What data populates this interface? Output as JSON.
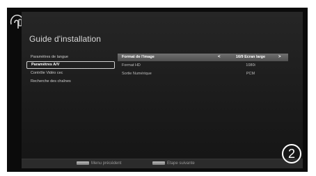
{
  "app": {
    "title": "Guide d'installation"
  },
  "menu": {
    "items": [
      {
        "label": "Paramètres de langue",
        "selected": false
      },
      {
        "label": "Paramètres A/V",
        "selected": true
      },
      {
        "label": "Contrôle Vidéo cec",
        "selected": false
      },
      {
        "label": "Recherche des chaînes",
        "selected": false
      }
    ]
  },
  "settings": {
    "rows": [
      {
        "label": "Format de l'image",
        "value": "16/9 Ecran large",
        "arrow_left": "<",
        "arrow_right": ">",
        "highlighted": true
      },
      {
        "label": "Format HD",
        "value": "1080i",
        "highlighted": false
      },
      {
        "label": "Sortie Numérique",
        "value": "PCM",
        "highlighted": false
      }
    ]
  },
  "footer": {
    "previous_label": "Menu précédent",
    "next_label": "Etape suivante"
  },
  "step": {
    "number": "2"
  },
  "icons": [
    "remote-hand-icon",
    "left-arrow-icon",
    "right-arrow-icon",
    "red-key-icon",
    "green-key-icon"
  ],
  "colors": {
    "highlight": "#5f5f5f",
    "panel": "#1f1f1f",
    "text": "#d9d9d9"
  }
}
